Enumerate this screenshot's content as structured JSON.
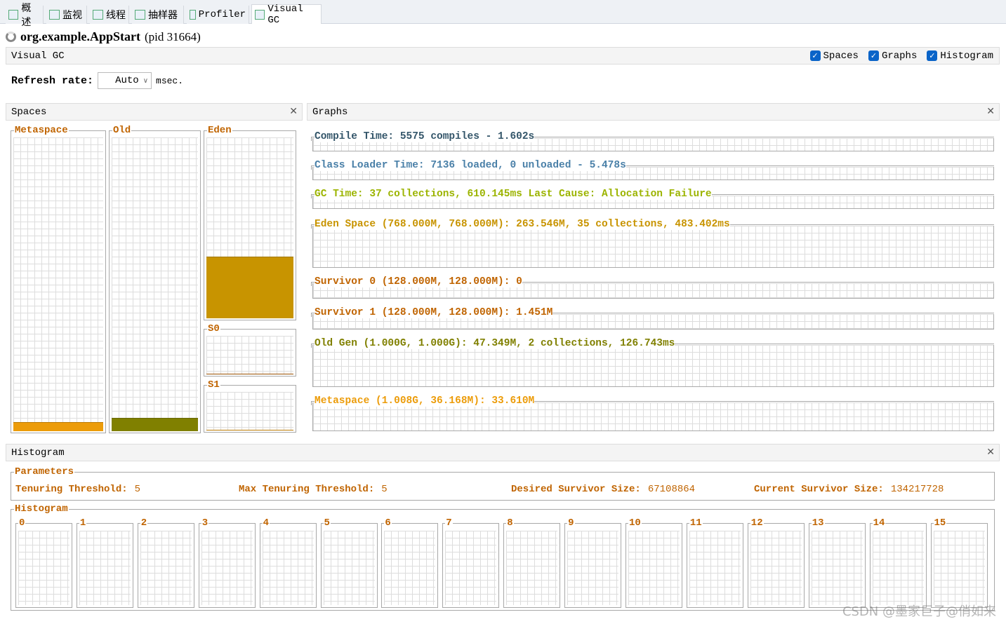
{
  "tabs": [
    {
      "label": "概述",
      "icon": "overview-icon"
    },
    {
      "label": "监视",
      "icon": "monitor-icon"
    },
    {
      "label": "线程",
      "icon": "threads-icon"
    },
    {
      "label": "抽样器",
      "icon": "sampler-icon"
    },
    {
      "label": "Profiler",
      "icon": "profiler-icon"
    },
    {
      "label": "Visual GC",
      "icon": "visualgc-icon",
      "active": true
    }
  ],
  "app": {
    "name": "org.example.AppStart",
    "pid": "(pid 31664)"
  },
  "header": {
    "title": "Visual GC",
    "checkboxes": [
      {
        "label": "Spaces",
        "checked": true
      },
      {
        "label": "Graphs",
        "checked": true
      },
      {
        "label": "Histogram",
        "checked": true
      }
    ]
  },
  "refresh": {
    "label": "Refresh rate:",
    "value": "Auto",
    "unit": "msec."
  },
  "spaces": {
    "title": "Spaces",
    "metaspace": "Metaspace",
    "old": "Old",
    "eden": "Eden",
    "s0": "S0",
    "s1": "S1",
    "fill": {
      "metaspace": 0.03,
      "old": 0.045,
      "eden": 0.34,
      "s0": 0,
      "s1": 0.011
    }
  },
  "graphs": {
    "title": "Graphs",
    "rows": [
      {
        "label": "Compile Time: 5575 compiles - 1.602s",
        "color": "#34566a"
      },
      {
        "label": "Class Loader Time: 7136 loaded, 0 unloaded - 5.478s",
        "color": "#4a80a8"
      },
      {
        "label": "GC Time: 37 collections, 610.145ms Last Cause: Allocation Failure",
        "color": "#9cb400"
      },
      {
        "label": "Eden Space (768.000M, 768.000M): 263.546M, 35 collections, 483.402ms",
        "color": "#c89400"
      },
      {
        "label": "Survivor 0 (128.000M, 128.000M): 0",
        "color": "#c06400"
      },
      {
        "label": "Survivor 1 (128.000M, 128.000M): 1.451M",
        "color": "#c06400"
      },
      {
        "label": "Old Gen (1.000G, 1.000G): 47.349M, 2 collections, 126.743ms",
        "color": "#808000"
      },
      {
        "label": "Metaspace (1.008G, 36.168M): 33.610M",
        "color": "#ec9c0a"
      }
    ]
  },
  "histogram": {
    "title": "Histogram",
    "parameters_title": "Parameters",
    "params": [
      {
        "label": "Tenuring Threshold:",
        "value": "5"
      },
      {
        "label": "Max Tenuring Threshold:",
        "value": "5"
      },
      {
        "label": "Desired Survivor Size:",
        "value": "67108864"
      },
      {
        "label": "Current Survivor Size:",
        "value": "134217728"
      }
    ],
    "histogram_title": "Histogram",
    "ages": [
      "0",
      "1",
      "2",
      "3",
      "4",
      "5",
      "6",
      "7",
      "8",
      "9",
      "10",
      "11",
      "12",
      "13",
      "14",
      "15"
    ]
  },
  "watermark": "CSDN @墨家巨子@俏如来",
  "colors": {
    "label": "#c06400",
    "old": "#808000",
    "eden": "#c89400",
    "metaspace": "#ec9c0a",
    "checkbox": "#0a64c8"
  }
}
